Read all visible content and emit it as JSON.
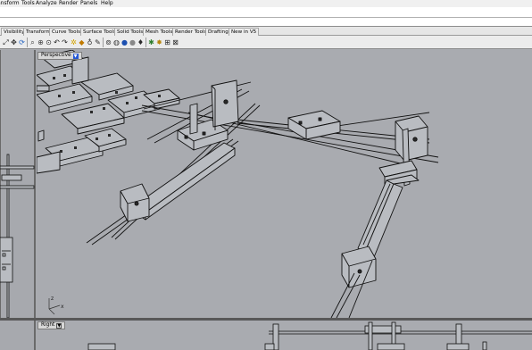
{
  "menu": {
    "items": [
      "ansform",
      "Tools",
      "Analyze",
      "Render",
      "Panels",
      "Help"
    ]
  },
  "tabs": [
    "Visibility",
    "Transform",
    "Curve Tools",
    "Surface Tools",
    "Solid Tools",
    "Mesh Tools",
    "Render Tools",
    "Drafting",
    "New in V5"
  ],
  "toolbar_icons": [
    "zoom-extents-icon",
    "pan-icon",
    "rotate-view-icon",
    "zoom-window-icon",
    "zoom-dynamic-icon",
    "zoom-selected-icon",
    "undo-view-icon",
    "redo-view-icon",
    "select-icon",
    "layer-icon",
    "lightbulb-icon",
    "properties-icon",
    "options-icon",
    "render-sphere-icon",
    "color-sphere-icon",
    "render-settings-icon",
    "tools-icon",
    "grid-snap-icon",
    "osnap-icon",
    "help-icon"
  ],
  "viewports": {
    "main": {
      "label": "Perspective",
      "arrow": "▼"
    },
    "bottom": {
      "label": "Right",
      "arrow": "▼"
    }
  },
  "axis_labels": {
    "z": "z",
    "x": "x"
  },
  "colors": {
    "viewport_bg": "#a9abb0",
    "part_fill": "#b9bcc1",
    "edge": "#111111",
    "active_tab": "#2458d6"
  }
}
